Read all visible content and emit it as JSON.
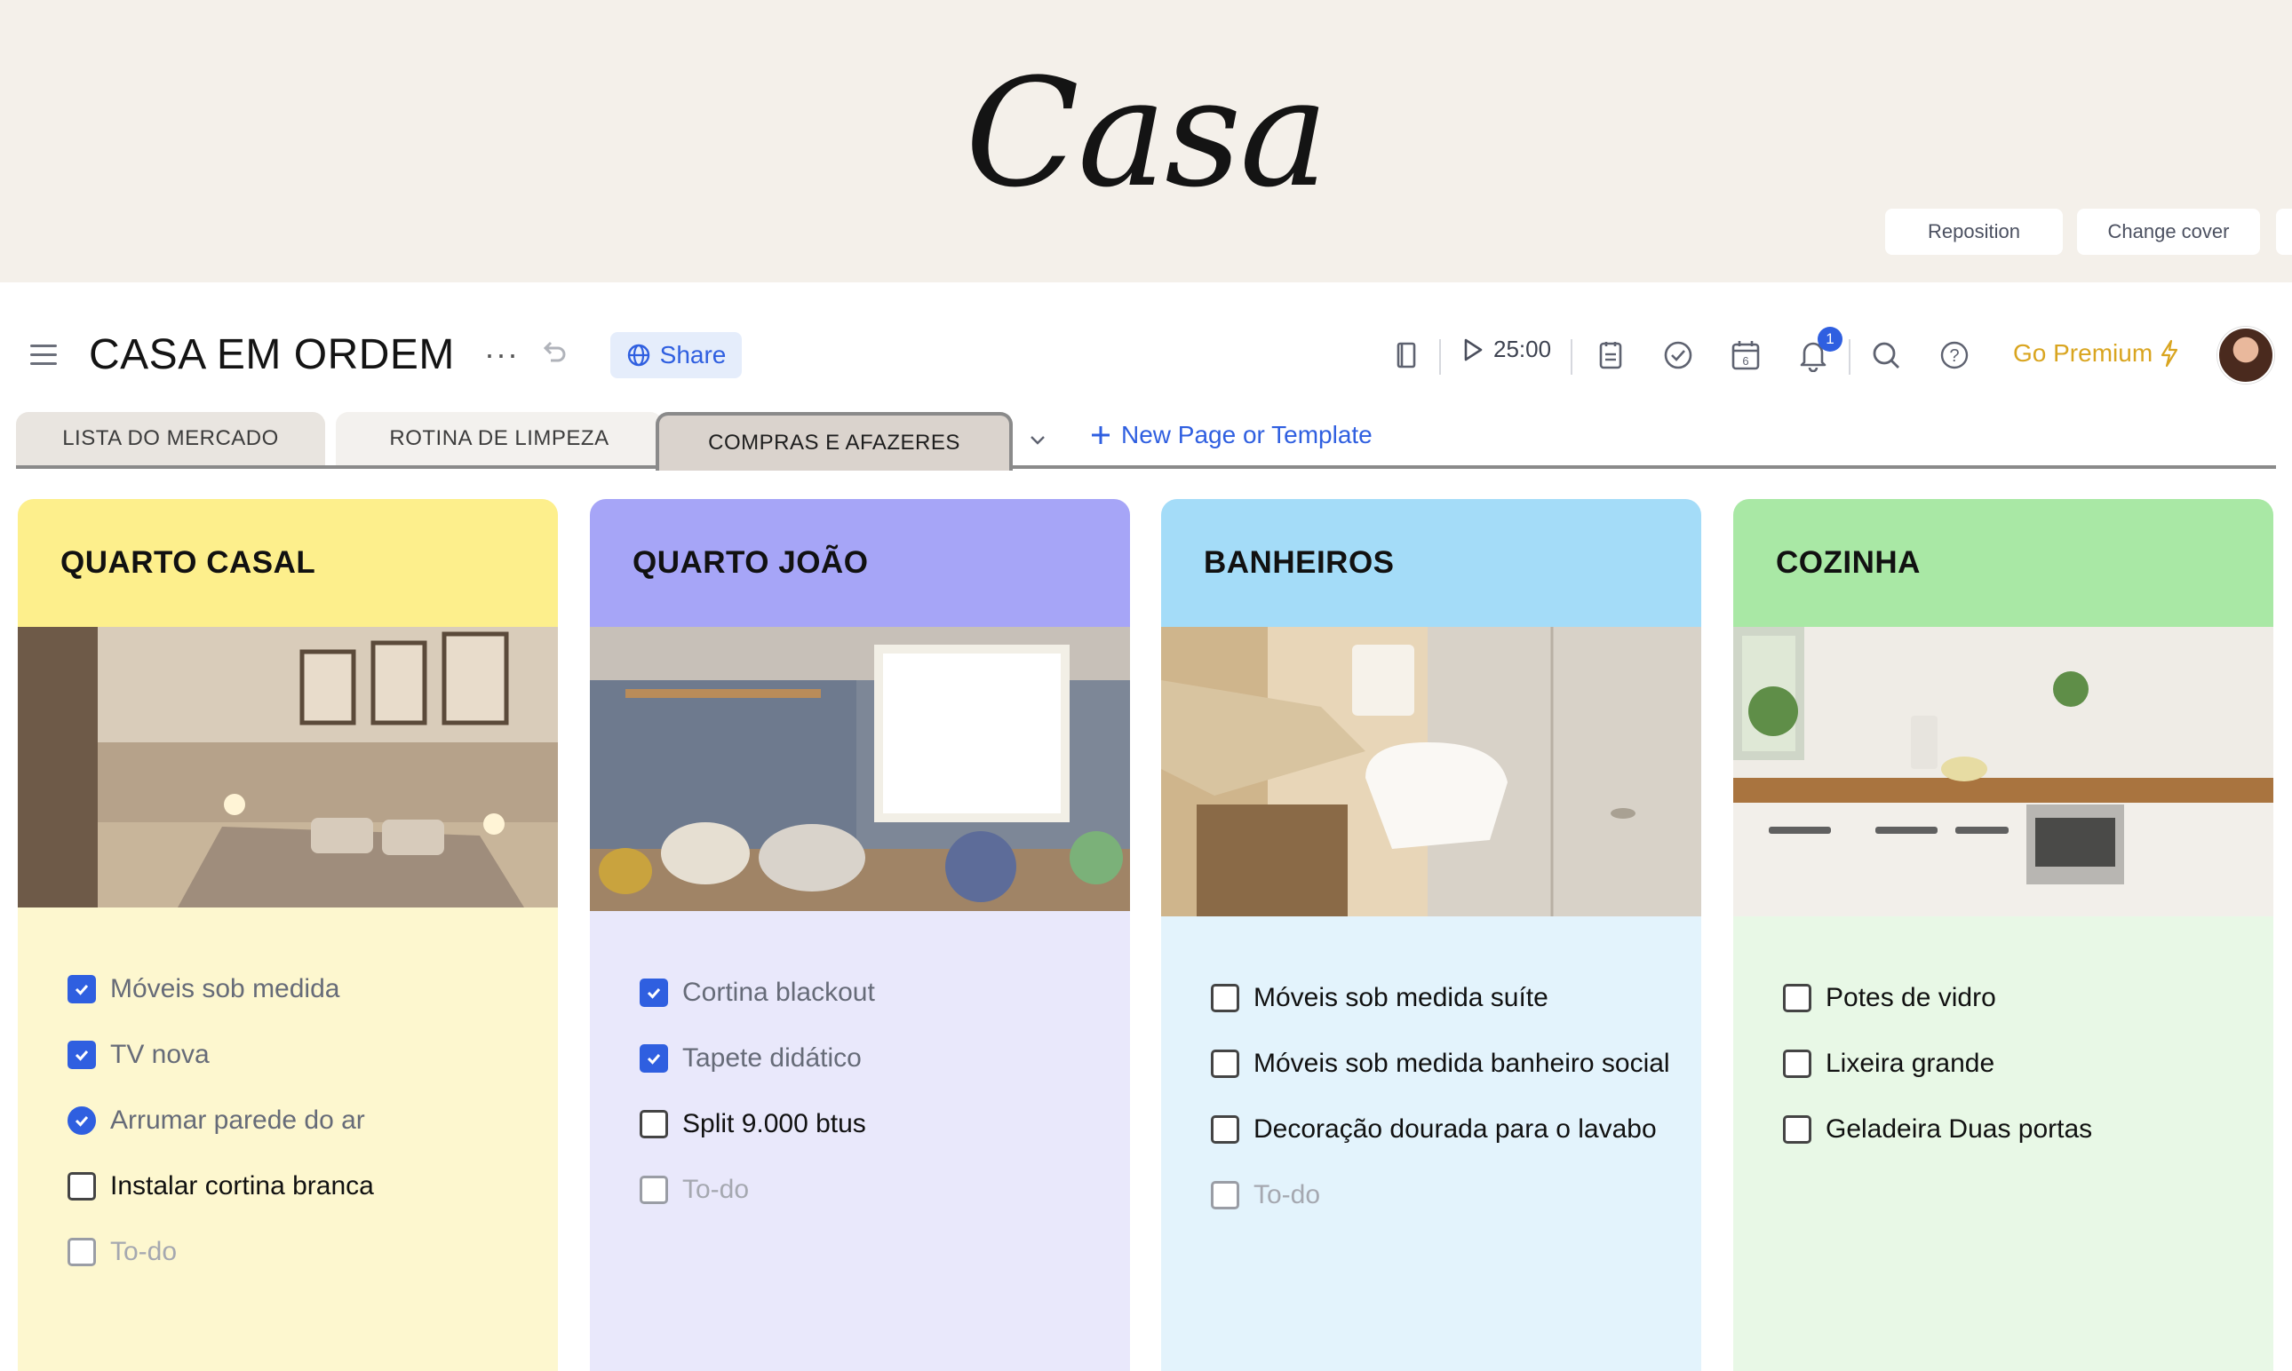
{
  "cover": {
    "title": "Casa",
    "reposition_label": "Reposition",
    "change_cover_label": "Change cover"
  },
  "header": {
    "page_title": "CASA EM ORDEM",
    "share_label": "Share",
    "timer": "25:00",
    "notification_count": "1",
    "calendar_day": "6",
    "premium_label": "Go Premium"
  },
  "tabs": [
    {
      "label": "LISTA DO MERCADO"
    },
    {
      "label": "ROTINA DE LIMPEZA"
    },
    {
      "label": "COMPRAS E AFAZERES"
    }
  ],
  "new_page_label": "New Page or Template",
  "columns": [
    {
      "title": "QUARTO CASAL",
      "header_color": "#fdef8c",
      "body_color": "#fdf7cf",
      "items": [
        {
          "text": "Móveis sob medida",
          "checked": true
        },
        {
          "text": "TV nova",
          "checked": true
        },
        {
          "text": "Arrumar parede do ar",
          "checked": true
        },
        {
          "text": "Instalar cortina branca",
          "checked": false
        }
      ],
      "placeholder": "To-do"
    },
    {
      "title": "QUARTO JOÃO",
      "header_color": "#a6a5f7",
      "body_color": "#e9e8fb",
      "items": [
        {
          "text": "Cortina blackout",
          "checked": true
        },
        {
          "text": "Tapete didático",
          "checked": true
        },
        {
          "text": "Split 9.000 btus",
          "checked": false
        }
      ],
      "placeholder": "To-do"
    },
    {
      "title": "BANHEIROS",
      "header_color": "#a4dcf8",
      "body_color": "#e3f3fc",
      "items": [
        {
          "text": "Móveis sob medida suíte",
          "checked": false
        },
        {
          "text": "Móveis sob medida banheiro social",
          "checked": false
        },
        {
          "text": "Decoração dourada para o lavabo",
          "checked": false
        }
      ],
      "placeholder": "To-do"
    },
    {
      "title": "COZINHA",
      "header_color": "#a9e8a5",
      "body_color": "#e8f8e6",
      "items": [
        {
          "text": "Potes de vidro",
          "checked": false
        },
        {
          "text": "Lixeira grande",
          "checked": false
        },
        {
          "text": "Geladeira Duas portas",
          "checked": false
        }
      ]
    }
  ]
}
